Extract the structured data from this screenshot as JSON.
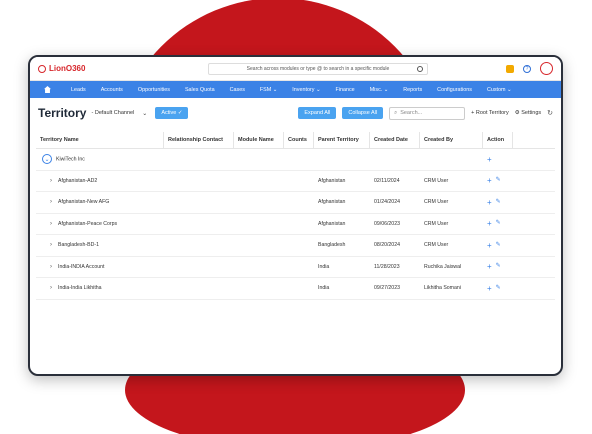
{
  "brand": {
    "name": "LionO360",
    "accent": "#d7262b",
    "nav_color": "#3b82e6",
    "background_circle": "#c4161c"
  },
  "search": {
    "placeholder": "Search across modules or type @ to search in a specific module"
  },
  "nav": {
    "items": [
      "Leads",
      "Accounts",
      "Opportunities",
      "Sales Quota",
      "Cases",
      "FSM ⌄",
      "Inventory ⌄",
      "Finance",
      "Misc. ⌄",
      "Reports",
      "Configurations",
      "Custom ⌄"
    ]
  },
  "toolbar": {
    "title": "Territory",
    "channel": "Default Channel",
    "status": "Active",
    "expand_all": "Expand All",
    "collapse_all": "Collapse All",
    "search_placeholder": "Search...",
    "root_territory": "Root Territory",
    "settings": "Settings"
  },
  "table": {
    "headers": [
      "Territory Name",
      "Relationship Contact",
      "Module Name",
      "Counts",
      "Parent Territory",
      "Created Date",
      "Created By",
      "Action"
    ],
    "root": "KiwiTech Inc",
    "rows": [
      {
        "name": "Afghanistan-AD2",
        "parent": "Afghanistan",
        "date": "02/11/2024",
        "by": "CRM User"
      },
      {
        "name": "Afghanistan-New AFG",
        "parent": "Afghanistan",
        "date": "01/24/2024",
        "by": "CRM User"
      },
      {
        "name": "Afghanistan-Peace Corps",
        "parent": "Afghanistan",
        "date": "09/06/2023",
        "by": "CRM User"
      },
      {
        "name": "Bangladesh-BD-1",
        "parent": "Bangladesh",
        "date": "08/20/2024",
        "by": "CRM User"
      },
      {
        "name": "India-INDIA Account",
        "parent": "India",
        "date": "11/28/2023",
        "by": "Ruchika Jaiswal"
      },
      {
        "name": "India-India Likhitha",
        "parent": "India",
        "date": "09/27/2023",
        "by": "Likhitha Somani"
      }
    ]
  }
}
